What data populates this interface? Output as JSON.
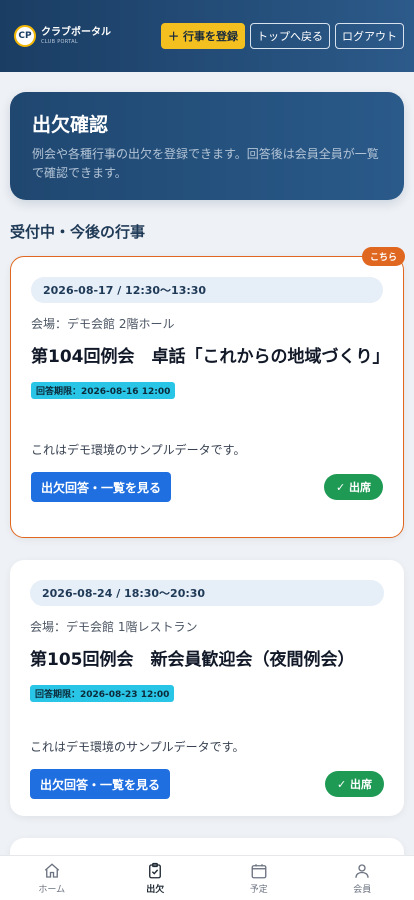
{
  "header": {
    "logo_badge": "CP",
    "logo_title": "クラブポータル",
    "logo_sub": "CLUB PORTAL",
    "register_label": "＋ 行事を登録",
    "top_label": "トップへ戻る",
    "logout_label": "ログアウト"
  },
  "hero": {
    "title": "出欠確認",
    "description": "例会や各種行事の出欠を登録できます。回答後は会員全員が一覧で確認できます。"
  },
  "section_title": "受付中・今後の行事",
  "events": [
    {
      "badge": "こちら",
      "datetime": "2026-08-17 / 12:30〜13:30",
      "venue": "会場：デモ会館 2階ホール",
      "title": "第104回例会　卓話「これからの地域づくり」",
      "deadline": "回答期限：2026-08-16 12:00",
      "description": "これはデモ環境のサンプルデータです。",
      "action_label": "出欠回答・一覧を見る",
      "status": "✓ 出席"
    },
    {
      "datetime": "2026-08-24 / 18:30〜20:30",
      "venue": "会場：デモ会館 1階レストラン",
      "title": "第105回例会　新会員歓迎会（夜間例会）",
      "deadline": "回答期限：2026-08-23 12:00",
      "description": "これはデモ環境のサンプルデータです。",
      "action_label": "出欠回答・一覧を見る",
      "status": "✓ 出席"
    }
  ],
  "nav": [
    {
      "label": "ホーム",
      "icon": "home-icon"
    },
    {
      "label": "出欠",
      "icon": "clipboard-check-icon",
      "active": true
    },
    {
      "label": "予定",
      "icon": "calendar-icon"
    },
    {
      "label": "会員",
      "icon": "user-icon"
    }
  ],
  "colors": {
    "header_bg": "#1a3d63",
    "accent_yellow": "#f4c020",
    "highlight_orange": "#e0671f",
    "primary_blue": "#1f6fe0",
    "status_green": "#1e9a55",
    "deadline_cyan": "#29c5e6"
  }
}
